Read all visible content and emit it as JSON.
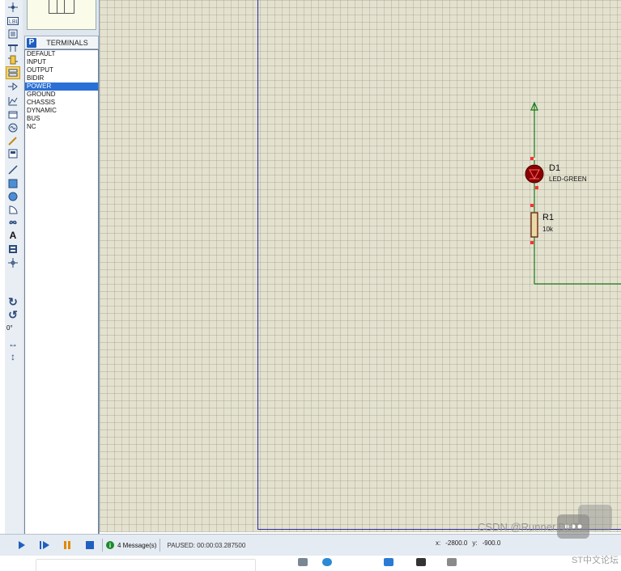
{
  "panel": {
    "header_letter": "P",
    "title": "TERMINALS",
    "items": [
      "DEFAULT",
      "INPUT",
      "OUTPUT",
      "BIDIR",
      "POWER",
      "GROUND",
      "CHASSIS",
      "DYNAMIC",
      "BUS",
      "NC"
    ],
    "selected": "POWER"
  },
  "toolbar": {
    "rotation_label": "0°",
    "tools": [
      "selection",
      "component",
      "junction",
      "wire-label",
      "text-script",
      "bus",
      "subcircuit",
      "terminals",
      "device-pins",
      "graph",
      "tape",
      "generator",
      "voltage-probe",
      "current-probe",
      "virtual-instruments",
      "line",
      "box",
      "circle",
      "arc",
      "path",
      "text",
      "symbol",
      "marker"
    ]
  },
  "schematic": {
    "d1": {
      "ref": "D1",
      "value": "LED-GREEN"
    },
    "r1": {
      "ref": "R1",
      "value": "10k"
    },
    "colors": {
      "wire": "#1a7a1a",
      "sheet_border": "#2a2aa8",
      "component": "#8b0000",
      "pin": "#ff3333",
      "background": "#e4e2cf"
    }
  },
  "statusbar": {
    "messages": "4 Message(s)",
    "sim_status": "PAUSED: 00:00:03.287500",
    "x_label": "x:",
    "x_value": "-2800.0",
    "y_label": "y:",
    "y_value": "-900.0"
  },
  "watermark": {
    "text": "CSDN @Runner.DUT",
    "sub": "ST中文论坛"
  }
}
